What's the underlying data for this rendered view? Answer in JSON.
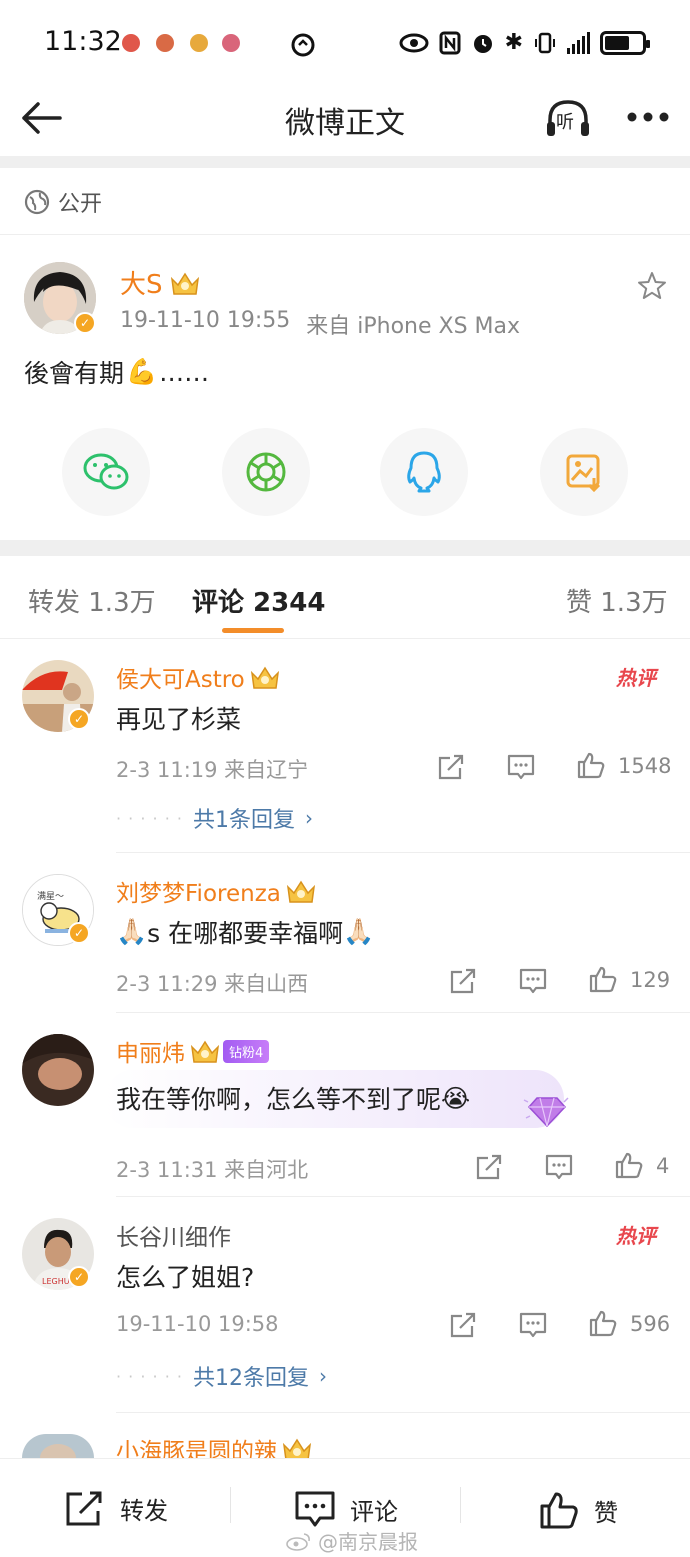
{
  "status_bar": {
    "time": "11:32",
    "notif_dots": [
      "#e0574a",
      "#d96a45",
      "#e7a93c",
      "#d9657a"
    ],
    "battery_percent": 60
  },
  "nav": {
    "title": "微博正文",
    "listen_label": "听"
  },
  "visibility": {
    "label": "公开"
  },
  "post": {
    "author": "大S",
    "date": "19-11-10 19:55",
    "source": "来自 iPhone XS Max",
    "text": "後會有期",
    "text_emoji": "💪",
    "text_tail": "……"
  },
  "share_targets": [
    {
      "icon": "wechat-icon",
      "color": "#2dc16c"
    },
    {
      "icon": "moments-icon",
      "color": "#54b83f"
    },
    {
      "icon": "qq-icon",
      "color": "#2ba6e8"
    },
    {
      "icon": "save-image-icon",
      "color": "#f2a83b"
    }
  ],
  "tabs": {
    "repost": "转发 1.3万",
    "comments": "评论 2344",
    "likes": "赞 1.3万"
  },
  "comments": [
    {
      "name": "侯大可Astro",
      "text": "再见了杉菜",
      "meta": "2-3 11:19  来自辽宁",
      "likes": "1548",
      "hot": "热评",
      "replies": "共1条回复"
    },
    {
      "name": "刘梦梦Fiorenza",
      "text_prefix": "🙏🏻",
      "text": "s 在哪都要幸福啊",
      "text_suffix": "🙏🏻",
      "meta": "2-3 11:29  来自山西",
      "likes": "129",
      "avatar_text": "满星～"
    },
    {
      "name": "申丽炜",
      "fan_badge": "钻粉4",
      "text": "我在等你啊，怎么等不到了呢",
      "text_emoji": "😭",
      "meta": "2-3 11:31  来自河北",
      "likes": "4"
    },
    {
      "name": "长谷川细作",
      "text": "怎么了姐姐?",
      "meta": "19-11-10 19:58",
      "likes": "596",
      "hot": "热评",
      "replies": "共12条回复"
    },
    {
      "name": "小海豚是圆的辣"
    }
  ],
  "bottom_bar": {
    "repost": "转发",
    "comment": "评论",
    "like": "赞"
  },
  "watermark": "@南京晨报",
  "colors": {
    "orange_name": "#f07e1b",
    "tab_underline": "#f38d2a",
    "link_blue": "#4d7aa8",
    "hot_red": "#e8474d"
  }
}
